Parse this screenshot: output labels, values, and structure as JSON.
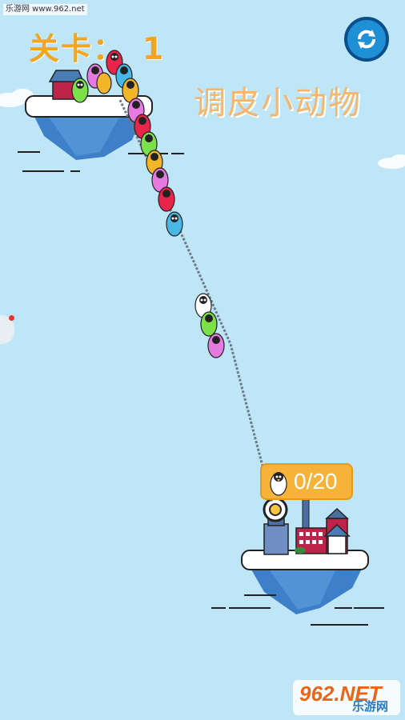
{
  "watermark_top": "乐游网 www.962.net",
  "level": {
    "label": "关卡：",
    "number": "1"
  },
  "title": "调皮小动物",
  "counter": {
    "text": "0/20"
  },
  "watermark_bottom": {
    "big": "962.NET",
    "small": "乐游网"
  },
  "colors": {
    "sky": "#bfe6f7",
    "accent_orange": "#f2a51e",
    "island_ice": "#3d7fc9",
    "snow": "#ffffff",
    "rope": "#6b7b8c",
    "button_blue": "#1f8fd6"
  },
  "icons": {
    "refresh": "refresh-icon",
    "penguin": "penguin-icon"
  }
}
